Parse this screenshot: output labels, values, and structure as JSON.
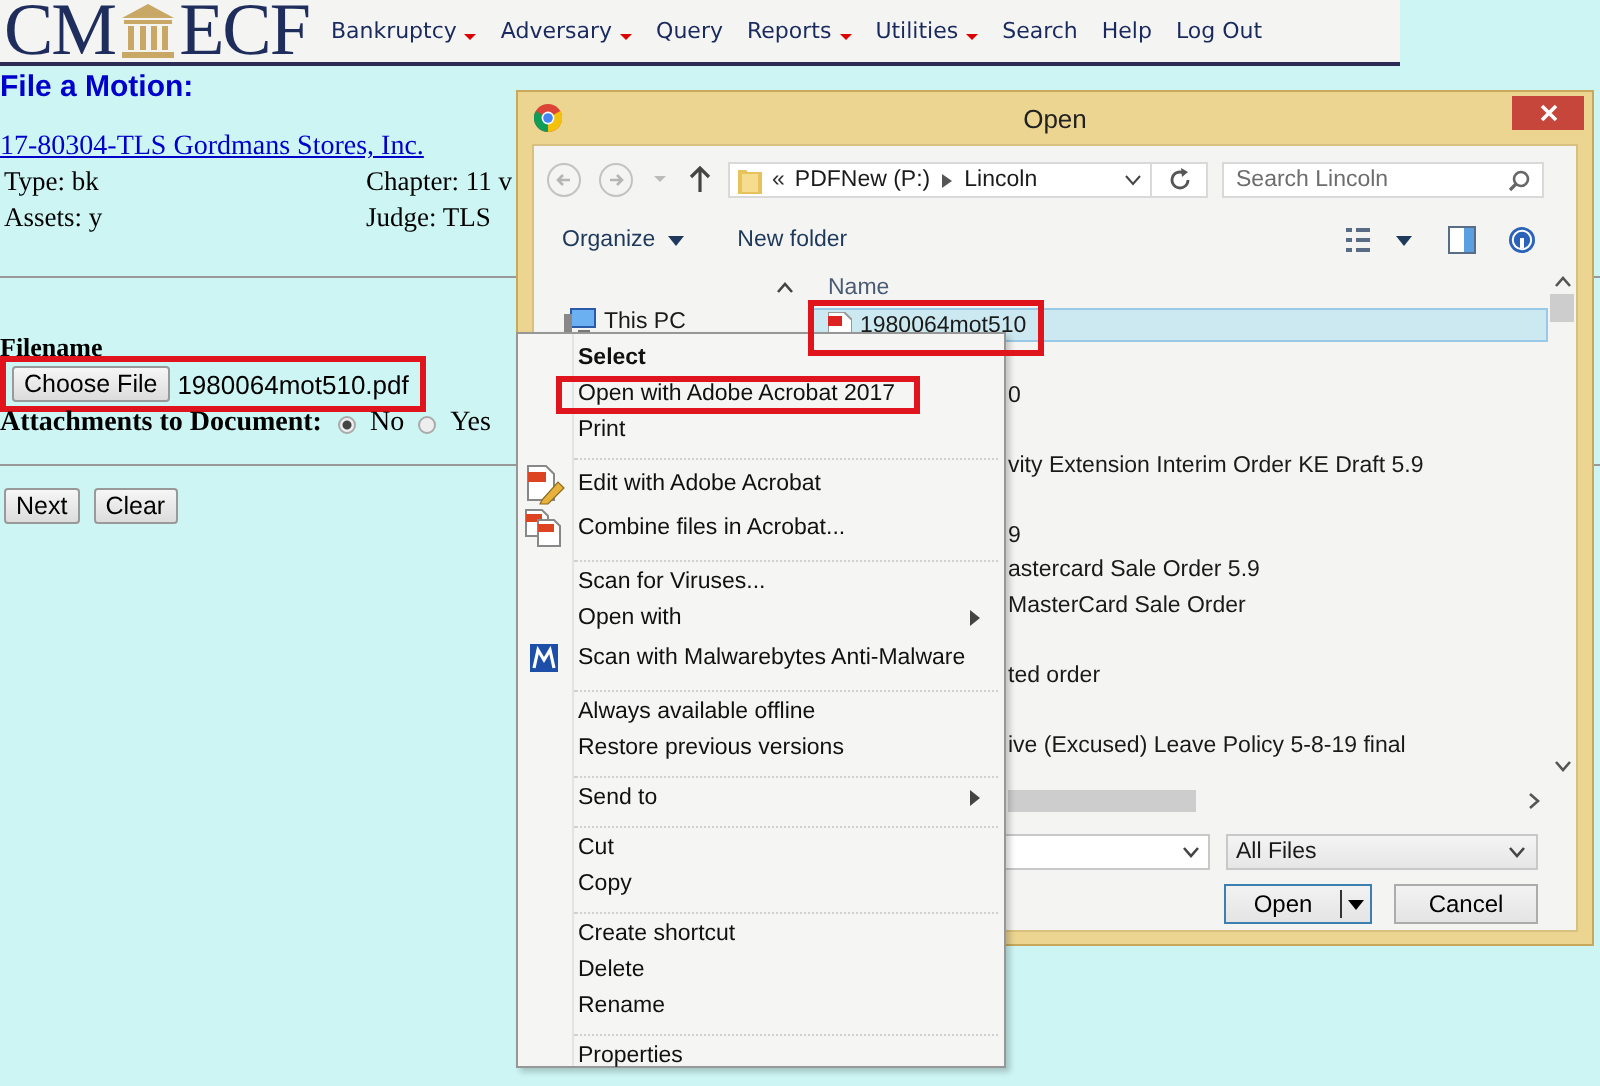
{
  "header": {
    "logo_left": "CM",
    "logo_right": "ECF",
    "nav": [
      {
        "label": "Bankruptcy",
        "dropdown": true
      },
      {
        "label": "Adversary",
        "dropdown": true
      },
      {
        "label": "Query",
        "dropdown": false
      },
      {
        "label": "Reports",
        "dropdown": true
      },
      {
        "label": "Utilities",
        "dropdown": true
      },
      {
        "label": "Search",
        "dropdown": false
      },
      {
        "label": "Help",
        "dropdown": false
      },
      {
        "label": "Log Out",
        "dropdown": false
      }
    ]
  },
  "page": {
    "title": "File a Motion:",
    "case_link": "17-80304-TLS Gordmans Stores, Inc. ",
    "details": [
      {
        "left": "Type: bk",
        "right": "Chapter: 11 v"
      },
      {
        "left": "Assets: y",
        "right": "Judge: TLS"
      }
    ],
    "filename_label": "Filename",
    "choose_button": "Choose File",
    "chosen_file": "1980064mot510.pdf",
    "file_highlighted": true,
    "attachments": {
      "label": "Attachments to Document:",
      "options": [
        {
          "label": "No",
          "selected": true
        },
        {
          "label": "Yes",
          "selected": false
        }
      ]
    },
    "buttons": [
      "Next",
      "Clear"
    ]
  },
  "dialog": {
    "title": "Open",
    "path_prefix": "«",
    "path": [
      "PDFNew (P:)",
      "Lincoln"
    ],
    "search": {
      "placeholder": "Search Lincoln"
    },
    "toolbar": [
      "Organize",
      "New folder"
    ],
    "nav_pane": [
      "This PC"
    ],
    "column": "Name",
    "selected_file_highlighted": true,
    "files": [
      {
        "name": "1980064mot510",
        "selected": true
      },
      {
        "name": "0",
        "selected": false
      },
      {
        "name": "vity Extension Interim Order KE Draft 5.9",
        "selected": false
      },
      {
        "name": "9",
        "selected": false
      },
      {
        "name": "astercard Sale Order 5.9",
        "selected": false
      },
      {
        "name": "MasterCard Sale Order",
        "selected": false
      },
      {
        "name": "ted order",
        "selected": false
      },
      {
        "name": "ive (Excused) Leave Policy 5-8-19 final",
        "selected": false
      }
    ],
    "filter": "All Files",
    "buttons": [
      "Open",
      "Cancel"
    ]
  },
  "context_menu": {
    "groups": [
      [
        {
          "label": "Select",
          "default": true,
          "submenu": false,
          "highlighted": false
        },
        {
          "label": "Open with Adobe Acrobat 2017",
          "default": false,
          "submenu": false,
          "highlighted": true
        },
        {
          "label": "Print",
          "default": false,
          "submenu": false,
          "highlighted": false
        }
      ],
      [
        {
          "label": "Edit with Adobe Acrobat",
          "default": false,
          "submenu": false,
          "highlighted": false
        },
        {
          "label": "Combine files in Acrobat...",
          "default": false,
          "submenu": false,
          "highlighted": false
        }
      ],
      [
        {
          "label": "Scan for Viruses...",
          "default": false,
          "submenu": false,
          "highlighted": false
        },
        {
          "label": "Open with",
          "default": false,
          "submenu": true,
          "highlighted": false
        },
        {
          "label": "Scan with Malwarebytes Anti-Malware",
          "default": false,
          "submenu": false,
          "highlighted": false
        }
      ],
      [
        {
          "label": "Always available offline",
          "default": false,
          "submenu": false,
          "highlighted": false
        },
        {
          "label": "Restore previous versions",
          "default": false,
          "submenu": false,
          "highlighted": false
        }
      ],
      [
        {
          "label": "Send to",
          "default": false,
          "submenu": true,
          "highlighted": false
        }
      ],
      [
        {
          "label": "Cut",
          "default": false,
          "submenu": false,
          "highlighted": false
        },
        {
          "label": "Copy",
          "default": false,
          "submenu": false,
          "highlighted": false
        }
      ],
      [
        {
          "label": "Create shortcut",
          "default": false,
          "submenu": false,
          "highlighted": false
        },
        {
          "label": "Delete",
          "default": false,
          "submenu": false,
          "highlighted": false
        },
        {
          "label": "Rename",
          "default": false,
          "submenu": false,
          "highlighted": false
        }
      ],
      [
        {
          "label": "Properties",
          "default": false,
          "submenu": false,
          "highlighted": false
        }
      ]
    ]
  }
}
